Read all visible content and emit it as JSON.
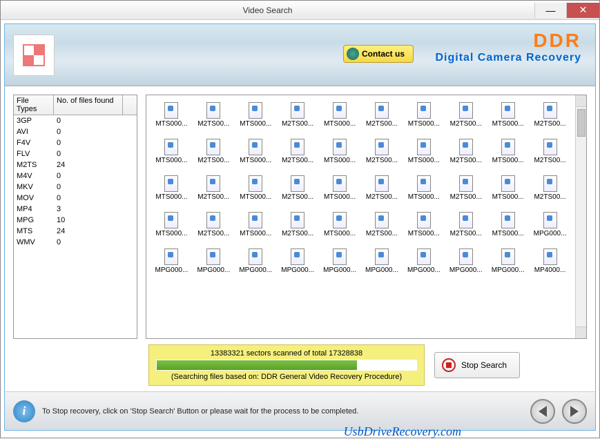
{
  "window": {
    "title": "Video Search"
  },
  "title_buttons": {
    "min": "—",
    "close": "✕"
  },
  "header": {
    "contact": "Contact us",
    "brand": "DDR",
    "brand_sub": "Digital Camera Recovery"
  },
  "file_table": {
    "col1": "File Types",
    "col2": "No. of files found",
    "rows": [
      {
        "type": "3GP",
        "count": "0"
      },
      {
        "type": "AVI",
        "count": "0"
      },
      {
        "type": "F4V",
        "count": "0"
      },
      {
        "type": "FLV",
        "count": "0"
      },
      {
        "type": "M2TS",
        "count": "24"
      },
      {
        "type": "M4V",
        "count": "0"
      },
      {
        "type": "MKV",
        "count": "0"
      },
      {
        "type": "MOV",
        "count": "0"
      },
      {
        "type": "MP4",
        "count": "3"
      },
      {
        "type": "MPG",
        "count": "10"
      },
      {
        "type": "MTS",
        "count": "24"
      },
      {
        "type": "WMV",
        "count": "0"
      }
    ]
  },
  "grid": {
    "labels": [
      "MTS000...",
      "M2TS00...",
      "MTS000...",
      "M2TS00...",
      "MTS000...",
      "M2TS00...",
      "MTS000...",
      "M2TS00...",
      "MTS000...",
      "M2TS00...",
      "MTS000...",
      "M2TS00...",
      "MTS000...",
      "M2TS00...",
      "MTS000...",
      "M2TS00...",
      "MTS000...",
      "M2TS00...",
      "MTS000...",
      "M2TS00...",
      "MTS000...",
      "M2TS00...",
      "MTS000...",
      "M2TS00...",
      "MTS000...",
      "M2TS00...",
      "MTS000...",
      "M2TS00...",
      "MTS000...",
      "M2TS00...",
      "MTS000...",
      "M2TS00...",
      "MTS000...",
      "M2TS00...",
      "MTS000...",
      "M2TS00...",
      "MTS000...",
      "M2TS00...",
      "MTS000...",
      "MPG000...",
      "MPG000...",
      "MPG000...",
      "MPG000...",
      "MPG000...",
      "MPG000...",
      "MPG000...",
      "MPG000...",
      "MPG000...",
      "MPG000...",
      "MP4000..."
    ]
  },
  "status": {
    "line1": "13383321 sectors scanned of total 17328838",
    "progress_pct": 77,
    "line2": "(Searching files based on:  DDR General Video Recovery Procedure)"
  },
  "stop_button": "Stop Search",
  "footer": {
    "info_glyph": "i",
    "text": "To Stop recovery, click on 'Stop Search' Button or please wait for the process to be completed."
  },
  "website": "UsbDriveRecovery.com"
}
